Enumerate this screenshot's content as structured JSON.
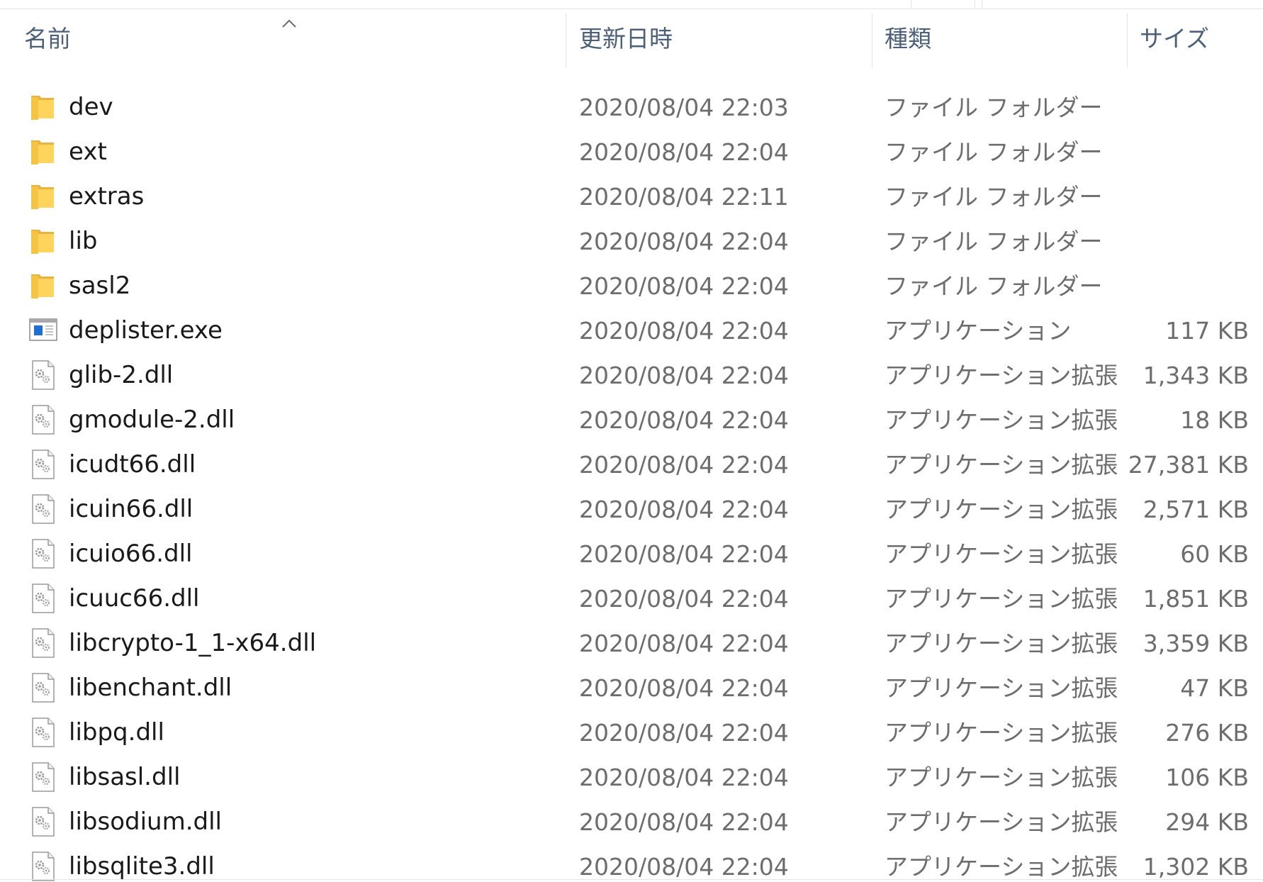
{
  "columns": {
    "name": "名前",
    "modified": "更新日時",
    "type": "種類",
    "size": "サイズ"
  },
  "files": [
    {
      "name": "dev",
      "modified": "2020/08/04 22:03",
      "type": "ファイル フォルダー",
      "size": "",
      "icon": "folder-icon"
    },
    {
      "name": "ext",
      "modified": "2020/08/04 22:04",
      "type": "ファイル フォルダー",
      "size": "",
      "icon": "folder-icon"
    },
    {
      "name": "extras",
      "modified": "2020/08/04 22:11",
      "type": "ファイル フォルダー",
      "size": "",
      "icon": "folder-icon"
    },
    {
      "name": "lib",
      "modified": "2020/08/04 22:04",
      "type": "ファイル フォルダー",
      "size": "",
      "icon": "folder-icon"
    },
    {
      "name": "sasl2",
      "modified": "2020/08/04 22:04",
      "type": "ファイル フォルダー",
      "size": "",
      "icon": "folder-icon"
    },
    {
      "name": "deplister.exe",
      "modified": "2020/08/04 22:04",
      "type": "アプリケーション",
      "size": "117 KB",
      "icon": "application-icon"
    },
    {
      "name": "glib-2.dll",
      "modified": "2020/08/04 22:04",
      "type": "アプリケーション拡張",
      "size": "1,343 KB",
      "icon": "dll-file-icon"
    },
    {
      "name": "gmodule-2.dll",
      "modified": "2020/08/04 22:04",
      "type": "アプリケーション拡張",
      "size": "18 KB",
      "icon": "dll-file-icon"
    },
    {
      "name": "icudt66.dll",
      "modified": "2020/08/04 22:04",
      "type": "アプリケーション拡張",
      "size": "27,381 KB",
      "icon": "dll-file-icon"
    },
    {
      "name": "icuin66.dll",
      "modified": "2020/08/04 22:04",
      "type": "アプリケーション拡張",
      "size": "2,571 KB",
      "icon": "dll-file-icon"
    },
    {
      "name": "icuio66.dll",
      "modified": "2020/08/04 22:04",
      "type": "アプリケーション拡張",
      "size": "60 KB",
      "icon": "dll-file-icon"
    },
    {
      "name": "icuuc66.dll",
      "modified": "2020/08/04 22:04",
      "type": "アプリケーション拡張",
      "size": "1,851 KB",
      "icon": "dll-file-icon"
    },
    {
      "name": "libcrypto-1_1-x64.dll",
      "modified": "2020/08/04 22:04",
      "type": "アプリケーション拡張",
      "size": "3,359 KB",
      "icon": "dll-file-icon"
    },
    {
      "name": "libenchant.dll",
      "modified": "2020/08/04 22:04",
      "type": "アプリケーション拡張",
      "size": "47 KB",
      "icon": "dll-file-icon"
    },
    {
      "name": "libpq.dll",
      "modified": "2020/08/04 22:04",
      "type": "アプリケーション拡張",
      "size": "276 KB",
      "icon": "dll-file-icon"
    },
    {
      "name": "libsasl.dll",
      "modified": "2020/08/04 22:04",
      "type": "アプリケーション拡張",
      "size": "106 KB",
      "icon": "dll-file-icon"
    },
    {
      "name": "libsodium.dll",
      "modified": "2020/08/04 22:04",
      "type": "アプリケーション拡張",
      "size": "294 KB",
      "icon": "dll-file-icon"
    },
    {
      "name": "libsqlite3.dll",
      "modified": "2020/08/04 22:04",
      "type": "アプリケーション拡張",
      "size": "1,302 KB",
      "icon": "dll-file-icon"
    }
  ]
}
